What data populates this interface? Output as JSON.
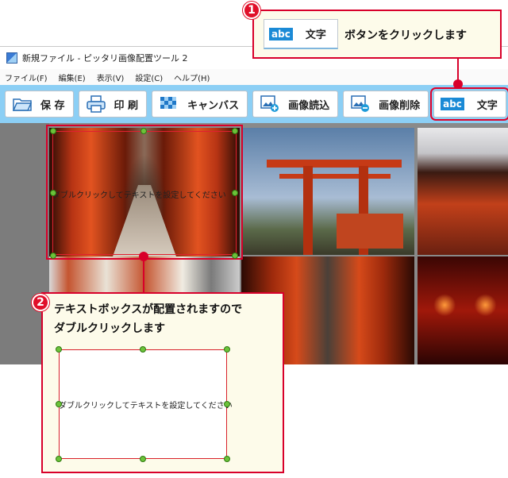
{
  "window": {
    "title": "新規ファイル - ピッタリ画像配置ツール 2"
  },
  "menu": {
    "items": [
      "ファイル(F)",
      "編集(E)",
      "表示(V)",
      "設定(C)",
      "ヘルプ(H)"
    ]
  },
  "toolbar": {
    "save": "保 存",
    "print": "印 刷",
    "canvas": "キャンバス",
    "import": "画像読込",
    "delete": "画像削除",
    "abc": "abc",
    "text": "文字"
  },
  "canvas": {
    "textbox_placeholder": "ダブルクリックしてテキストを設定してください"
  },
  "callout1": {
    "number": "1",
    "abc": "abc",
    "button_label": "文字",
    "message": "ボタンをクリックします"
  },
  "callout2": {
    "number": "2",
    "line1": "テキストボックスが配置されますので",
    "line2": "ダブルクリックします",
    "placeholder": "ダブルクリックしてテキストを設定してください"
  },
  "colors": {
    "accent_red": "#d8002a",
    "toolbar_bg": "#8ccff5",
    "handle_green": "#6cc23a",
    "callout_bg": "#fdfbea",
    "abc_blue": "#1a8ad6"
  }
}
